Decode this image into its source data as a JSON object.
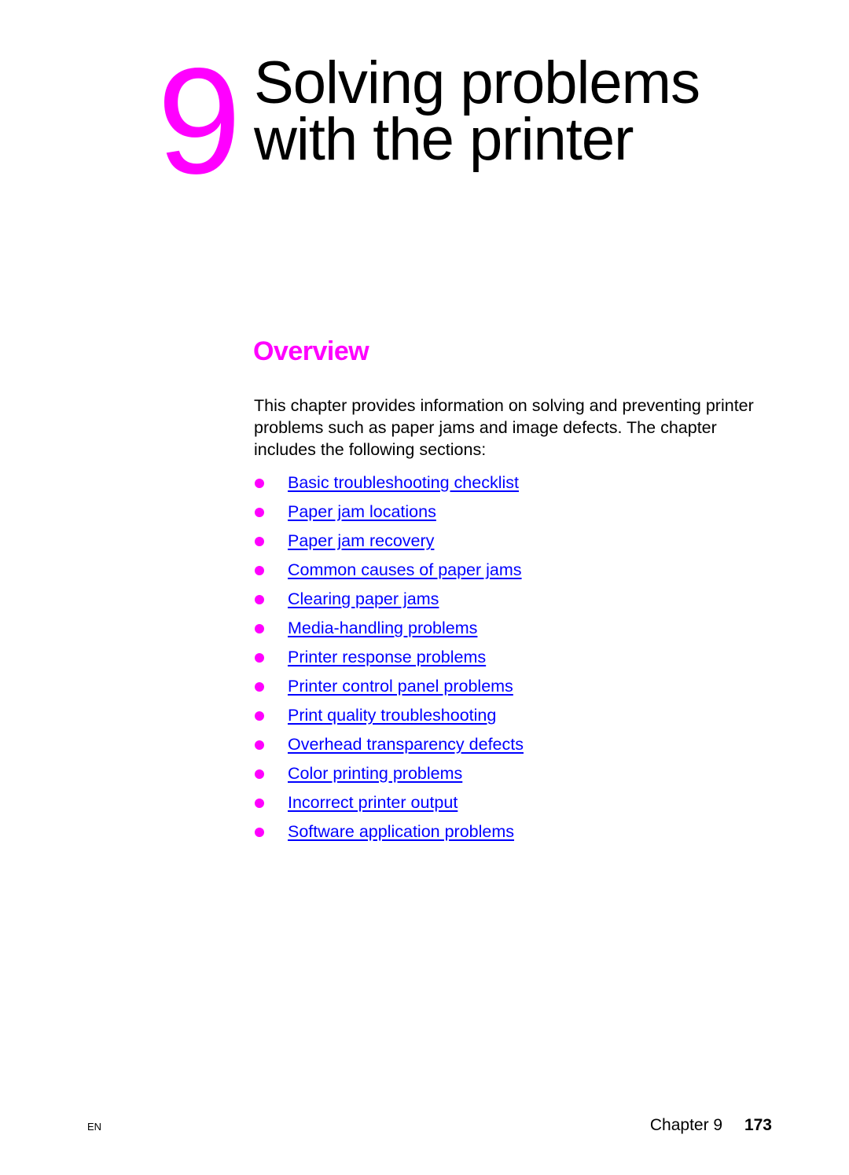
{
  "chapter": {
    "number": "9",
    "title_line1": "Solving problems",
    "title_line2": "with the printer"
  },
  "overview": {
    "heading": "Overview",
    "intro": "This chapter provides information on solving and preventing printer problems such as paper jams and image defects. The chapter includes the following sections:",
    "sections": [
      {
        "label": "Basic troubleshooting checklist"
      },
      {
        "label": "Paper jam locations"
      },
      {
        "label": "Paper jam recovery"
      },
      {
        "label": "Common causes of paper jams"
      },
      {
        "label": "Clearing paper jams"
      },
      {
        "label": "Media-handling problems"
      },
      {
        "label": "Printer response problems"
      },
      {
        "label": "Printer control panel problems"
      },
      {
        "label": "Print quality troubleshooting"
      },
      {
        "label": "Overhead transparency defects"
      },
      {
        "label": "Color printing problems"
      },
      {
        "label": "Incorrect printer output"
      },
      {
        "label": "Software application problems"
      }
    ]
  },
  "footer": {
    "language": "EN",
    "chapter_label": "Chapter 9",
    "page_number": "173"
  },
  "colors": {
    "accent": "#ff00ff",
    "link": "#0000ff",
    "text": "#000000"
  }
}
